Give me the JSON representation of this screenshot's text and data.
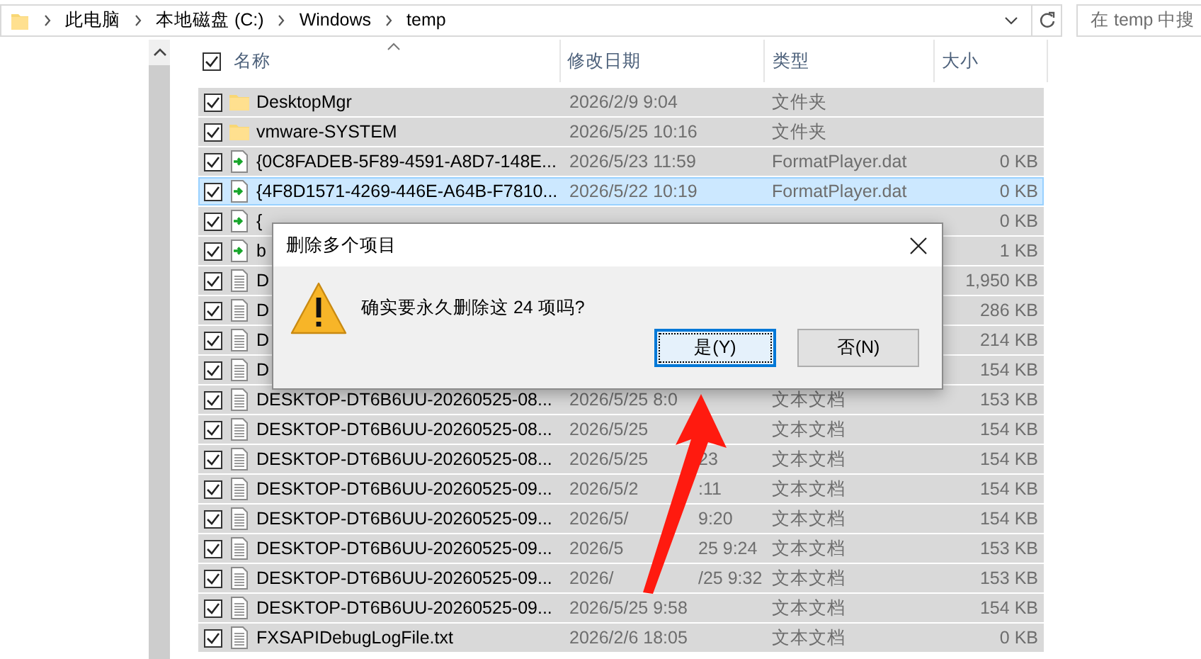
{
  "address_bar": {
    "segments": [
      "此电脑",
      "本地磁盘 (C:)",
      "Windows",
      "temp"
    ]
  },
  "search": {
    "placeholder": "在 temp 中搜"
  },
  "header": {
    "checked": true,
    "columns": [
      {
        "label": "名称",
        "sorted": true
      },
      {
        "label": "修改日期",
        "sorted": false
      },
      {
        "label": "类型",
        "sorted": false
      },
      {
        "label": "大小",
        "sorted": false
      }
    ]
  },
  "rows": [
    {
      "kind": "folder",
      "name": "DesktopMgr",
      "date": "2026/2/9 9:04",
      "type": "文件夹",
      "checked": true,
      "selected": true,
      "focused": false
    },
    {
      "kind": "folder",
      "name": "vmware-SYSTEM",
      "date": "2026/5/25 10:16",
      "type": "文件夹",
      "checked": true,
      "selected": true,
      "focused": false
    },
    {
      "kind": "shortcut",
      "name": "{0C8FADEB-5F89-4591-A8D7-148E...",
      "date": "2026/5/23 11:59",
      "type": "FormatPlayer.dat",
      "size": "0 KB",
      "checked": true,
      "selected": true,
      "focused": false
    },
    {
      "kind": "shortcut",
      "name": "{4F8D1571-4269-446E-A64B-F7810...",
      "date": "2026/5/22 10:19",
      "type": "FormatPlayer.dat",
      "size": "0 KB",
      "checked": true,
      "selected": true,
      "focused": true
    },
    {
      "kind": "shortcut",
      "name": "{",
      "size": "0 KB",
      "checked": true,
      "selected": true,
      "focused": false
    },
    {
      "kind": "shortcut",
      "name": "b",
      "size": "1 KB",
      "checked": true,
      "selected": true,
      "focused": false
    },
    {
      "kind": "text",
      "name": "D",
      "size": "1,950 KB",
      "checked": true,
      "selected": true,
      "focused": false
    },
    {
      "kind": "text",
      "name": "D",
      "size": "286 KB",
      "checked": true,
      "selected": true,
      "focused": false
    },
    {
      "kind": "text",
      "name": "D",
      "size": "214 KB",
      "checked": true,
      "selected": true,
      "focused": false
    },
    {
      "kind": "text",
      "name": "D",
      "size": "154 KB",
      "checked": true,
      "selected": true,
      "focused": false
    },
    {
      "kind": "text",
      "name": "DESKTOP-DT6B6UU-20260525-08...",
      "date": "2026/5/25 8:0",
      "type": "文本文档",
      "size": "153 KB",
      "checked": true,
      "selected": true,
      "focused": false
    },
    {
      "kind": "text",
      "name": "DESKTOP-DT6B6UU-20260525-08...",
      "date": "2026/5/25",
      "type": "文本文档",
      "size": "154 KB",
      "checked": true,
      "selected": true,
      "focused": false
    },
    {
      "kind": "text",
      "name": "DESKTOP-DT6B6UU-20260525-08...",
      "date": "2026/5/25",
      "date_tail": "23",
      "type": "文本文档",
      "size": "154 KB",
      "checked": true,
      "selected": true,
      "focused": false
    },
    {
      "kind": "text",
      "name": "DESKTOP-DT6B6UU-20260525-09...",
      "date": "2026/5/2",
      "date_tail": ":11",
      "type": "文本文档",
      "size": "154 KB",
      "checked": true,
      "selected": true,
      "focused": false
    },
    {
      "kind": "text",
      "name": "DESKTOP-DT6B6UU-20260525-09...",
      "date": "2026/5/",
      "date_tail": "9:20",
      "type": "文本文档",
      "size": "154 KB",
      "checked": true,
      "selected": true,
      "focused": false
    },
    {
      "kind": "text",
      "name": "DESKTOP-DT6B6UU-20260525-09...",
      "date": "2026/5",
      "date_tail": "25 9:24",
      "type": "文本文档",
      "size": "153 KB",
      "checked": true,
      "selected": true,
      "focused": false
    },
    {
      "kind": "text",
      "name": "DESKTOP-DT6B6UU-20260525-09...",
      "date": "2026/",
      "date_tail": "/25 9:32",
      "type": "文本文档",
      "size": "153 KB",
      "checked": true,
      "selected": true,
      "focused": false
    },
    {
      "kind": "text",
      "name": "DESKTOP-DT6B6UU-20260525-09...",
      "date": "2026/5/25 9:58",
      "type": "文本文档",
      "size": "154 KB",
      "checked": true,
      "selected": true,
      "focused": false
    },
    {
      "kind": "text",
      "name": "FXSAPIDebugLogFile.txt",
      "date": "2026/2/6 18:05",
      "type": "文本文档",
      "size": "0 KB",
      "checked": true,
      "selected": true,
      "focused": false
    }
  ],
  "dialog": {
    "title": "删除多个项目",
    "message": "确实要永久删除这 24 项吗?",
    "buttons": [
      {
        "label": "是(Y)",
        "default": true
      },
      {
        "label": "否(N)",
        "default": false
      }
    ]
  }
}
